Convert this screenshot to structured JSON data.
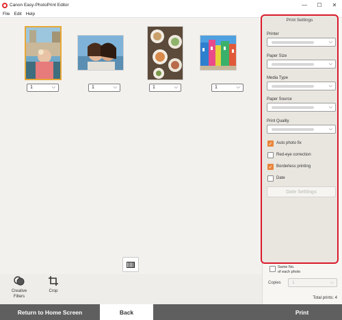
{
  "window": {
    "title": "Canon Easy-PhotoPrint Editor",
    "minimize_glyph": "—",
    "maximize_glyph": "☐",
    "close_glyph": "✕"
  },
  "menu": [
    "File",
    "Edit",
    "Help"
  ],
  "photos": [
    {
      "qty": "1",
      "selected": true,
      "subject": "child-with-ice-cream"
    },
    {
      "qty": "1",
      "selected": false,
      "subject": "selfie-two-women"
    },
    {
      "qty": "1",
      "selected": false,
      "subject": "food-plates-table"
    },
    {
      "qty": "1",
      "selected": false,
      "subject": "colorful-houses-street"
    }
  ],
  "tools": {
    "creative_filters": "Creative\nFilters",
    "crop": "Crop"
  },
  "print_settings": {
    "title": "Print Settings",
    "printer_label": "Printer",
    "paper_size_label": "Paper Size",
    "media_type_label": "Media Type",
    "paper_source_label": "Paper Source",
    "print_quality_label": "Print Quality",
    "auto_photo_fix": {
      "label": "Auto photo fix",
      "checked": true
    },
    "red_eye": {
      "label": "Red-eye correction",
      "checked": false
    },
    "borderless": {
      "label": "Borderless printing",
      "checked": true
    },
    "date": {
      "label": "Date",
      "checked": false
    },
    "date_settings": "Date Settings"
  },
  "same_no": {
    "label_line1": "Same No.",
    "label_line2": "of each photo",
    "checked": false
  },
  "copies": {
    "label": "Copies",
    "value": "1"
  },
  "total_prints": "Total prints: 4",
  "buttons": {
    "return_home": "Return to Home Screen",
    "back": "Back",
    "print": "Print"
  },
  "colors": {
    "accent_orange": "#e8853b",
    "highlight_red": "#d9192a",
    "selected_border": "#e8a735",
    "bottom_bar": "#5f5f5f"
  }
}
